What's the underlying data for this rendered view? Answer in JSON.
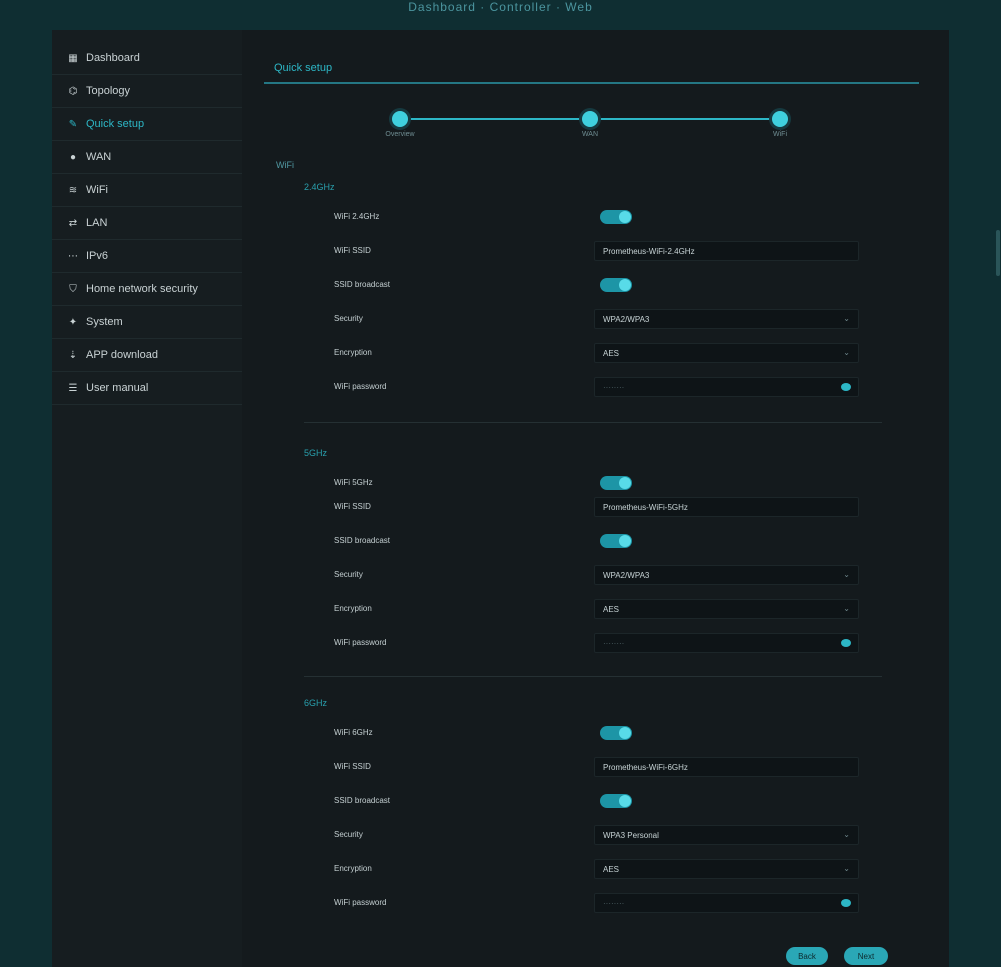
{
  "app": {
    "brand": "Dashboard · Controller · Web"
  },
  "sidebar": {
    "items": [
      {
        "label": "Dashboard",
        "icon": "grid-icon"
      },
      {
        "label": "Topology",
        "icon": "topology-icon"
      },
      {
        "label": "Quick setup",
        "icon": "wand-icon"
      },
      {
        "label": "WAN",
        "icon": "globe-icon"
      },
      {
        "label": "WiFi",
        "icon": "wifi-icon"
      },
      {
        "label": "LAN",
        "icon": "lan-icon"
      },
      {
        "label": "IPv6",
        "icon": "ipv6-icon"
      },
      {
        "label": "Home network security",
        "icon": "shield-icon"
      },
      {
        "label": "System",
        "icon": "wrench-icon"
      },
      {
        "label": "APP download",
        "icon": "download-icon"
      },
      {
        "label": "User manual",
        "icon": "book-icon"
      }
    ]
  },
  "main": {
    "title": "Quick setup",
    "steps": [
      "Overview",
      "WAN",
      "WiFi"
    ],
    "wifi_label": "WiFi"
  },
  "bands": [
    {
      "title": "2.4GHz",
      "enable_label": "WiFi 2.4GHz",
      "ssid_label": "WiFi SSID",
      "ssid_value": "Prometheus-WiFi-2.4GHz",
      "broadcast_label": "SSID broadcast",
      "security_label": "Security",
      "security_value": "WPA2/WPA3",
      "encryption_label": "Encryption",
      "encryption_value": "AES",
      "password_label": "WiFi password",
      "password_placeholder": "········"
    },
    {
      "title": "5GHz",
      "enable_label": "WiFi 5GHz",
      "ssid_label": "WiFi SSID",
      "ssid_value": "Prometheus-WiFi-5GHz",
      "broadcast_label": "SSID broadcast",
      "security_label": "Security",
      "security_value": "WPA2/WPA3",
      "encryption_label": "Encryption",
      "encryption_value": "AES",
      "password_label": "WiFi password",
      "password_placeholder": "········"
    },
    {
      "title": "6GHz",
      "enable_label": "WiFi 6GHz",
      "ssid_label": "WiFi SSID",
      "ssid_value": "Prometheus-WiFi-6GHz",
      "broadcast_label": "SSID broadcast",
      "security_label": "Security",
      "security_value": "WPA3 Personal",
      "encryption_label": "Encryption",
      "encryption_value": "AES",
      "password_label": "WiFi password",
      "password_placeholder": "········"
    }
  ],
  "buttons": {
    "back": "Back",
    "next": "Next"
  },
  "colors": {
    "accent": "#2db7c6",
    "background": "#141a1d",
    "outer": "#0f2e32"
  }
}
